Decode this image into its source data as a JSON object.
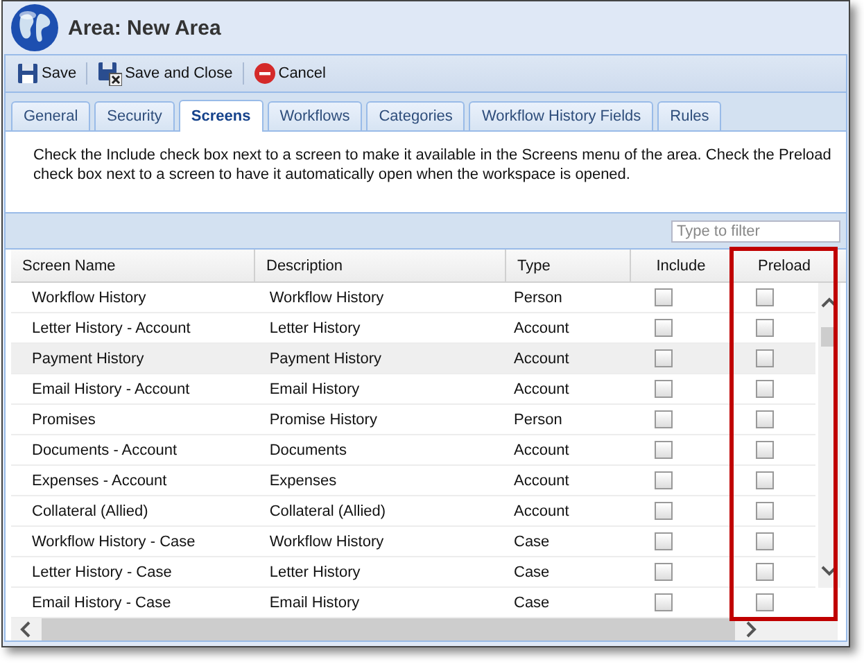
{
  "window": {
    "title": "Area: New Area"
  },
  "toolbar": [
    {
      "label": "Save",
      "kind": "save"
    },
    {
      "label": "Save and Close",
      "kind": "save-close"
    },
    {
      "label": "Cancel",
      "kind": "cancel"
    }
  ],
  "tabs": [
    {
      "label": "General",
      "selected": false
    },
    {
      "label": "Security",
      "selected": false
    },
    {
      "label": "Screens",
      "selected": true
    },
    {
      "label": "Workflows",
      "selected": false
    },
    {
      "label": "Categories",
      "selected": false
    },
    {
      "label": "Workflow History Fields",
      "selected": false
    },
    {
      "label": "Rules",
      "selected": false
    }
  ],
  "instructions": "Check the Include check box next to a screen to make it available in the Screens menu of the area. Check the Preload check box next to a screen to have it automatically open when the workspace is opened.",
  "filter": {
    "placeholder": "Type to filter"
  },
  "table": {
    "columns": [
      {
        "label": "Screen Name",
        "kind": "text",
        "highlighted": false
      },
      {
        "label": "Description",
        "kind": "text",
        "highlighted": false
      },
      {
        "label": "Type",
        "kind": "text",
        "highlighted": false
      },
      {
        "label": "Include",
        "kind": "check",
        "highlighted": false
      },
      {
        "label": "Preload",
        "kind": "check",
        "highlighted": true
      }
    ],
    "rows": [
      {
        "name": "Workflow History",
        "description": "Workflow History",
        "type": "Person",
        "include": false,
        "preload": false,
        "selected": false
      },
      {
        "name": "Letter History - Account",
        "description": "Letter History",
        "type": "Account",
        "include": false,
        "preload": false,
        "selected": false
      },
      {
        "name": "Payment History",
        "description": "Payment History",
        "type": "Account",
        "include": false,
        "preload": false,
        "selected": true
      },
      {
        "name": "Email History - Account",
        "description": "Email History",
        "type": "Account",
        "include": false,
        "preload": false,
        "selected": false
      },
      {
        "name": "Promises",
        "description": "Promise History",
        "type": "Person",
        "include": false,
        "preload": false,
        "selected": false
      },
      {
        "name": "Documents - Account",
        "description": "Documents",
        "type": "Account",
        "include": false,
        "preload": false,
        "selected": false
      },
      {
        "name": "Expenses - Account",
        "description": "Expenses",
        "type": "Account",
        "include": false,
        "preload": false,
        "selected": false
      },
      {
        "name": "Collateral (Allied)",
        "description": "Collateral (Allied)",
        "type": "Account",
        "include": false,
        "preload": false,
        "selected": false
      },
      {
        "name": "Workflow History - Case",
        "description": "Workflow History",
        "type": "Case",
        "include": false,
        "preload": false,
        "selected": false
      },
      {
        "name": "Letter History - Case",
        "description": "Letter History",
        "type": "Case",
        "include": false,
        "preload": false,
        "selected": false
      },
      {
        "name": "Email History - Case",
        "description": "Email History",
        "type": "Case",
        "include": false,
        "preload": false,
        "selected": false
      }
    ]
  }
}
